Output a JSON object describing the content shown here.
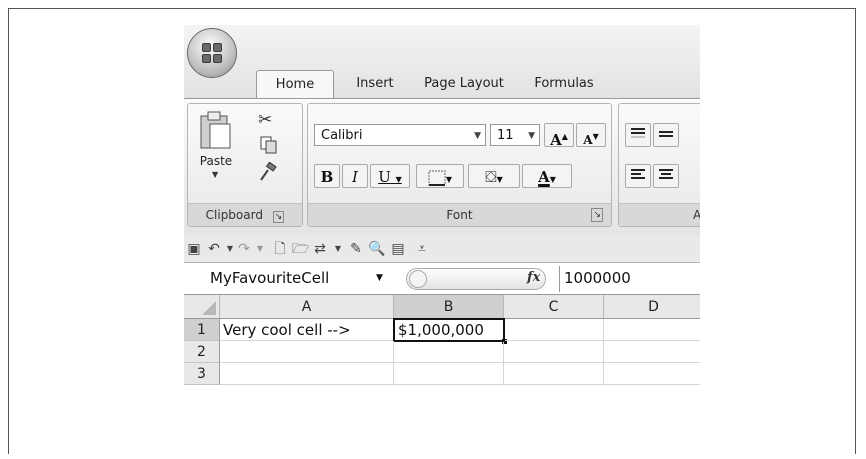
{
  "ribbon": {
    "tabs": [
      {
        "label": "Home"
      },
      {
        "label": "Insert"
      },
      {
        "label": "Page Layout"
      },
      {
        "label": "Formulas"
      }
    ],
    "clipboard": {
      "paste_label": "Paste",
      "group_label": "Clipboard"
    },
    "font": {
      "name": "Calibri",
      "size": "11",
      "group_label": "Font",
      "grow_label": "A",
      "shrink_label": "A",
      "bold": "B",
      "italic": "I",
      "underline": "U",
      "color_label": "A"
    },
    "alignment": {
      "group_label": "A"
    }
  },
  "formula_bar": {
    "name_box": "MyFavouriteCell",
    "fx": "fx",
    "value": "1000000"
  },
  "grid": {
    "columns": [
      "A",
      "B",
      "C",
      "D"
    ],
    "rows": [
      "1",
      "2",
      "3"
    ],
    "cells": {
      "A1": "Very cool cell -->",
      "B1": "$1,000,000"
    }
  }
}
